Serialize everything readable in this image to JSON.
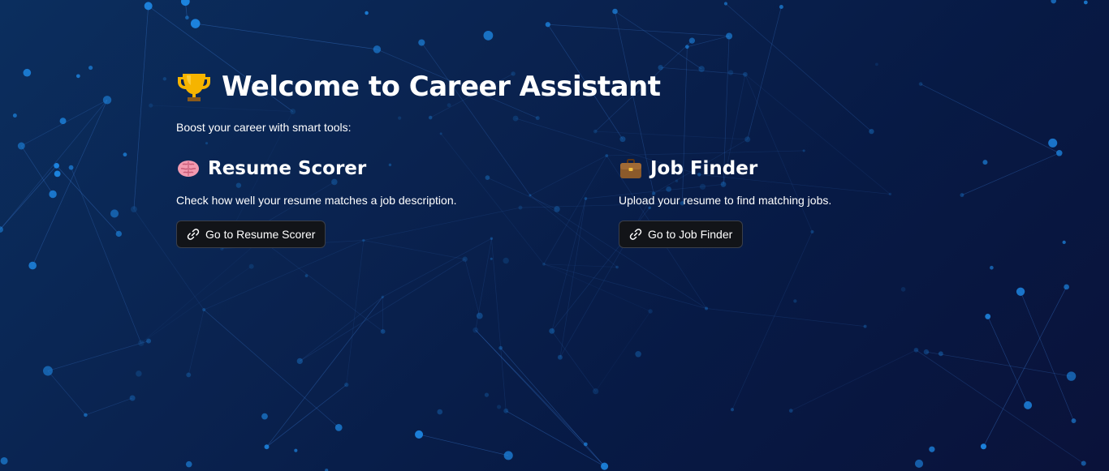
{
  "page": {
    "title": "Welcome to Career Assistant",
    "title_icon": "trophy-icon",
    "subtitle": "Boost your career with smart tools:"
  },
  "sections": [
    {
      "icon": "brain-icon",
      "title": "Resume Scorer",
      "description": "Check how well your resume matches a job description.",
      "button_icon": "link-icon",
      "button_label": "Go to Resume Scorer"
    },
    {
      "icon": "briefcase-icon",
      "title": "Job Finder",
      "description": "Upload your resume to find matching jobs.",
      "button_icon": "link-icon",
      "button_label": "Go to Job Finder"
    }
  ],
  "colors": {
    "background_top": "#0b2e5e",
    "background_bottom": "#0a123a",
    "button_bg": "#121418",
    "button_border": "#3a3f4a",
    "network_node": "#1e88e5"
  }
}
